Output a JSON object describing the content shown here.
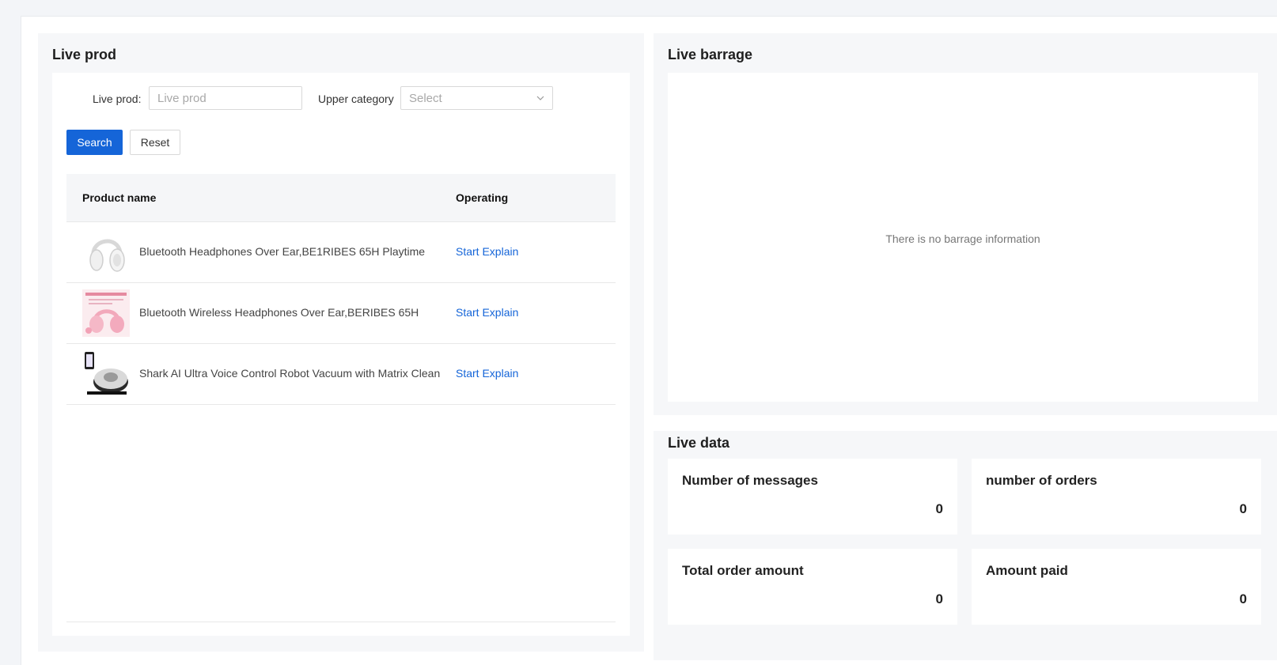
{
  "live_prod": {
    "title": "Live prod",
    "filter_label": "Live prod:",
    "filter_placeholder": "Live prod",
    "category_label": "Upper category",
    "category_placeholder": "Select",
    "search_label": "Search",
    "reset_label": "Reset",
    "columns": [
      "Product name",
      "Operating"
    ],
    "rows": [
      {
        "name": "Bluetooth Headphones Over Ear,BE1RIBES 65H Playtime",
        "action": "Start Explain",
        "thumb": "white-headphones"
      },
      {
        "name": "Bluetooth Wireless Headphones Over Ear,BERIBES 65H",
        "action": "Start Explain",
        "thumb": "pink-headphones"
      },
      {
        "name": "Shark AI Ultra Voice Control Robot Vacuum with Matrix Clean",
        "action": "Start Explain",
        "thumb": "robot-vacuum"
      }
    ]
  },
  "live_barrage": {
    "title": "Live barrage",
    "empty_text": "There is no barrage information"
  },
  "live_data": {
    "title": "Live data",
    "cards": [
      {
        "label": "Number of messages",
        "value": "0"
      },
      {
        "label": "number of orders",
        "value": "0"
      },
      {
        "label": "Total order amount",
        "value": "0"
      },
      {
        "label": "Amount paid",
        "value": "0"
      }
    ]
  },
  "colors": {
    "primary": "#1565d8",
    "panel_bg": "#f6f7f9"
  }
}
